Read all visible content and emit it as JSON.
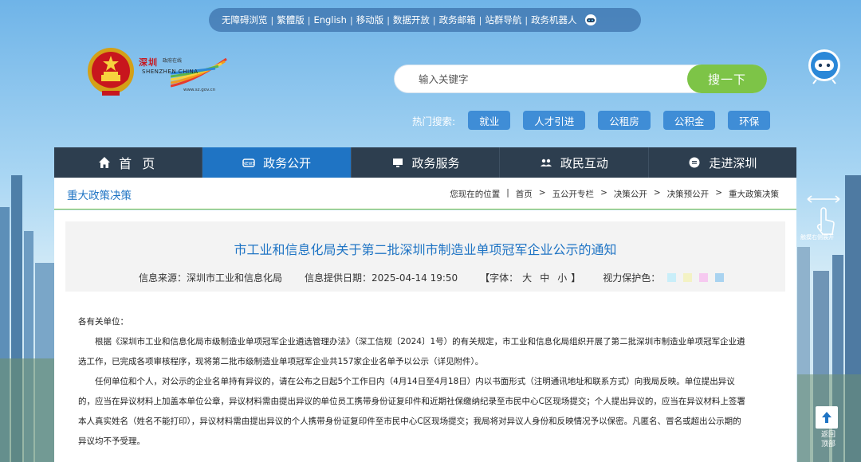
{
  "topbar": {
    "links": [
      "无障碍浏览",
      "繁體版",
      "English",
      "移动版",
      "数据开放",
      "政务邮箱",
      "站群导航",
      "政务机器人"
    ]
  },
  "logo": {
    "cn": "深圳",
    "small": "政府在线",
    "en": "SHENZHEN CHINA",
    "url": "www.sz.gov.cn"
  },
  "search": {
    "placeholder": "输入关键字",
    "button": "搜一下"
  },
  "hot": {
    "label": "热门搜索:",
    "tags": [
      "就业",
      "人才引进",
      "公租房",
      "公积金",
      "环保"
    ]
  },
  "nav": {
    "items": [
      "首 页",
      "政务公开",
      "政务服务",
      "政民互动",
      "走进深圳"
    ]
  },
  "section": {
    "title": "重大政策决策"
  },
  "breadcrumb": {
    "items": [
      "您现在的位置",
      "首页",
      "五公开专栏",
      "决策公开",
      "决策预公开",
      "重大政策决策"
    ],
    "separator": ">"
  },
  "article": {
    "title": "市工业和信息化局关于第二批深圳市制造业单项冠军企业公示的通知",
    "source": "信息来源：深圳市工业和信息化局",
    "date": "信息提供日期：2025-04-14 19:50",
    "font_label": "【字体：",
    "font_sizes": [
      "大",
      "中",
      "小"
    ],
    "font_end": "】",
    "eye_label": "视力保护色：",
    "eye_colors": [
      "#c9eef9",
      "#f3f2c4",
      "#f6c9f0",
      "#a9d3f0"
    ],
    "salutation": "各有关单位：",
    "p1_line1": "根据《深圳市工业和信息化局市级制造业单项冠军企业遴选管理办法》（深工信规〔2024〕1号）的有关规定，市工业和信息化局组织开展了第二批深圳市制造业单项冠军企业遴",
    "p1_line2": "选工作，已完成各项审核程序，现将第二批市级制造业单项冠军企业共157家企业名单予以公示（详见附件）。",
    "p2_line1": "任何单位和个人，对公示的企业名单持有异议的，请在公布之日起5个工作日内（4月14日至4月18日）内以书面形式（注明通讯地址和联系方式）向我局反映。单位提出异议",
    "p2_line2": "的，应当在异议材料上加盖本单位公章，异议材料需由提出异议的单位员工携带身份证复印件和近期社保缴纳纪录至市民中心C区现场提交；个人提出异议的，应当在异议材料上签署",
    "p2_line3": "本人真实姓名（姓名不能打印），异议材料需由提出异议的个人携带身份证复印件至市民中心C区现场提交；我局将对异议人身份和反映情况予以保密。凡匿名、冒名或超出公示期的",
    "p2_line4": "异议均不予受理。"
  },
  "side": {
    "swipe": "触摸右侧展开",
    "backtop": [
      "返回",
      "顶部"
    ]
  },
  "colors": {
    "nav_bg": "#2d3e4f",
    "nav_active": "#1f74c4",
    "accent_green": "#7dc447",
    "title_blue": "#1f74c4"
  }
}
